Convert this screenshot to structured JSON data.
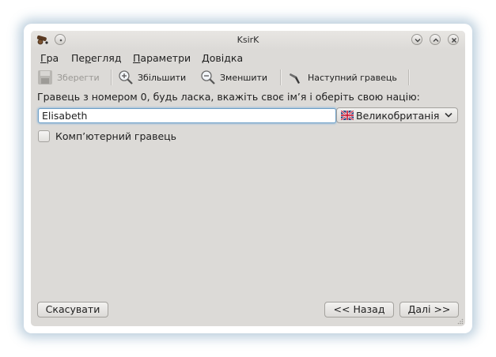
{
  "window": {
    "title": "KsirK",
    "app_icon": "cannon-icon",
    "controls": [
      "menu-dot-icon",
      "minimize-icon",
      "maximize-icon",
      "close-icon"
    ]
  },
  "menubar": {
    "items": [
      {
        "accel": "Г",
        "rest": "ра"
      },
      {
        "accel": "П",
        "mid": "е",
        "accel2": "р",
        "rest": "егляд",
        "full": "Перегляд"
      },
      {
        "accel": "П",
        "rest": "араметри"
      },
      {
        "accel": "Д",
        "rest": "овідка"
      }
    ]
  },
  "toolbar": {
    "save_label": "Зберегти",
    "zoom_in_label": "Збільшити",
    "zoom_out_label": "Зменшити",
    "next_player_label": "Наступний гравець"
  },
  "form": {
    "prompt": "Гравець з номером 0, будь ласка, вкажіть своє ім’я і оберіть свою націю:",
    "name_value": "Elisabeth",
    "nation_selected": "Великобританія",
    "computer_player_label": "Комп’ютерний гравець",
    "computer_player_checked": false
  },
  "buttons": {
    "cancel": "Скасувати",
    "back": "<< Назад",
    "next": "Далі >>"
  },
  "colors": {
    "window_bg": "#dcdad7",
    "focus_border": "#6ea0c8",
    "glow": "#4678a0"
  }
}
